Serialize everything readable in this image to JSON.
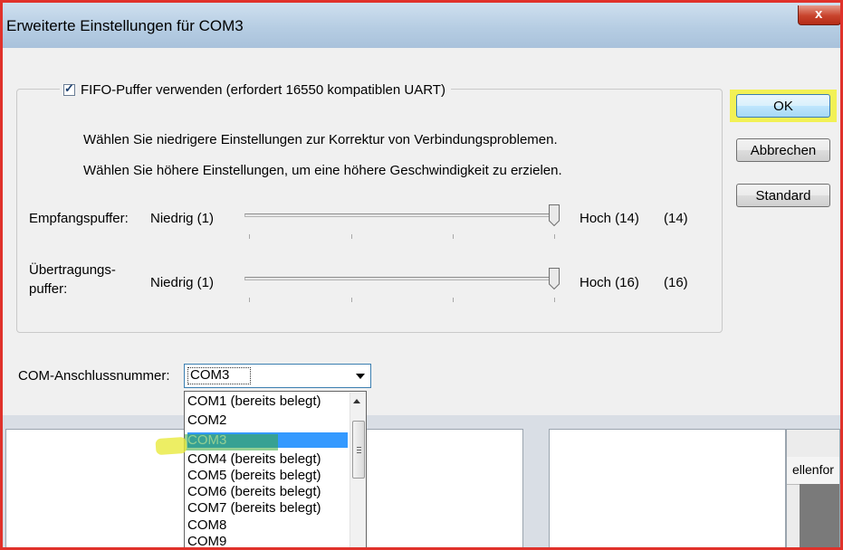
{
  "window": {
    "title": "Erweiterte Einstellungen für COM3",
    "close_label": "x"
  },
  "fifo": {
    "checkbox_label": "FIFO-Puffer verwenden (erfordert 16550 kompatiblen UART)",
    "checked": true,
    "hint_lower": "Wählen Sie niedrigere Einstellungen zur Korrektur von Verbindungsproblemen.",
    "hint_higher": "Wählen Sie höhere Einstellungen, um eine höhere Geschwindigkeit zu erzielen."
  },
  "receive_buffer": {
    "label": "Empfangspuffer:",
    "min_label": "Niedrig (1)",
    "max_label": "Hoch (14)",
    "value_label": "(14)",
    "value": 14,
    "min": 1,
    "max": 14
  },
  "transmit_buffer": {
    "label_line1": "Übertragungs-",
    "label_line2": "puffer:",
    "min_label": "Niedrig (1)",
    "max_label": "Hoch (16)",
    "value_label": "(16)",
    "value": 16,
    "min": 1,
    "max": 16
  },
  "buttons": {
    "ok": "OK",
    "cancel": "Abbrechen",
    "default": "Standard"
  },
  "com_port": {
    "label": "COM-Anschlussnummer:",
    "selected": "COM3",
    "options": [
      "COM1 (bereits belegt)",
      "COM2",
      "COM3",
      "COM4 (bereits belegt)",
      "COM5 (bereits belegt)",
      "COM6 (bereits belegt)",
      "COM7 (bereits belegt)",
      "COM8",
      "COM9"
    ],
    "highlighted_index": 2
  },
  "background": {
    "partial_text": "ellenfor"
  },
  "colors": {
    "annotation_frame": "#e0322b",
    "highlight": "#f2f13a",
    "selection": "#3399ff"
  }
}
